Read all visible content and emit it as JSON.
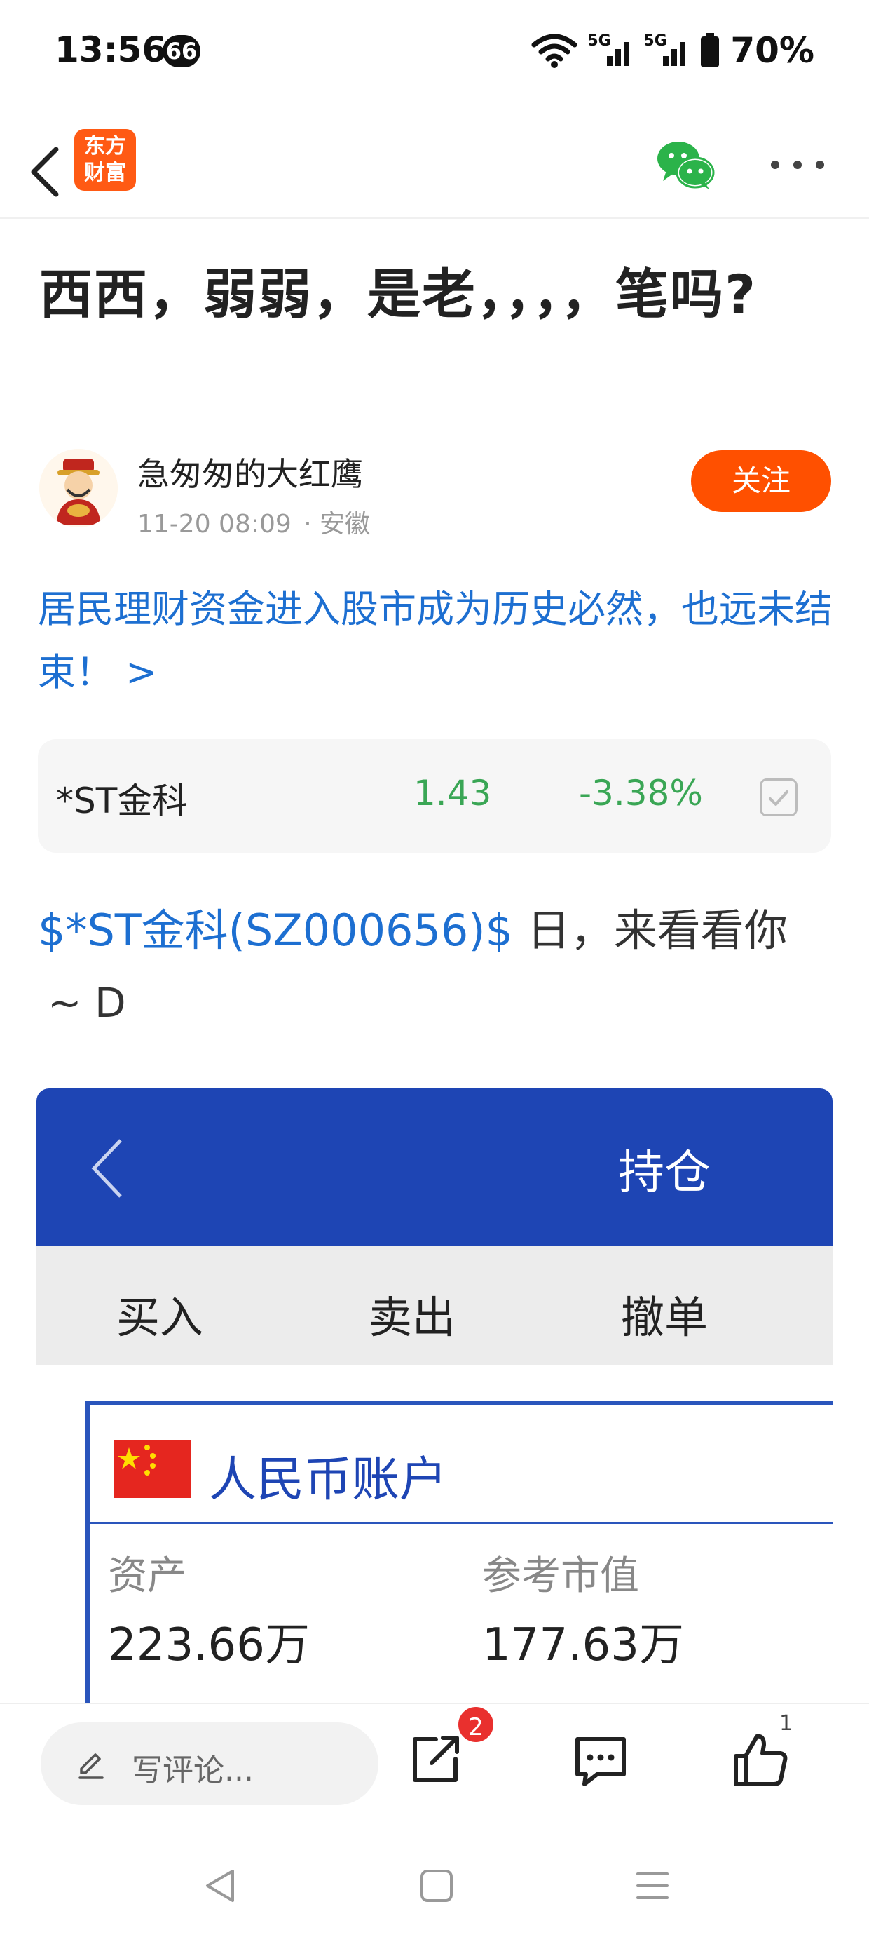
{
  "status_bar": {
    "time": "13:56",
    "notification_badge": "66",
    "network_1": "5G",
    "network_2": "5G",
    "battery": "70%"
  },
  "header": {
    "logo_line1": "东方",
    "logo_line2": "财富",
    "icons": [
      "back-icon",
      "wechat-icon",
      "more-icon"
    ]
  },
  "post": {
    "title": "西西，弱弱，是老，，，，笔吗?",
    "author": "急匆匆的大红鹰",
    "time": "11-20 08:09",
    "location": "· 安徽",
    "follow_label": "关注",
    "headline_link": "居民理财资金进入股市成为历史必然，也远未结束！ >",
    "body_stock_link": "$*ST金科(SZ000656)$",
    "body_text": " 日，来看看你",
    "body_line2": "~ D"
  },
  "stock_card": {
    "name": "*ST金科",
    "price": "1.43",
    "change": "-3.38%",
    "change_color": "#3aa655"
  },
  "embedded_screenshot": {
    "title": "持仓",
    "tabs": [
      "买入",
      "卖出",
      "撤单"
    ],
    "account_title": "人民币账户",
    "fields": [
      {
        "label": "资产",
        "value": "223.66万"
      },
      {
        "label": "参考市值",
        "value": "177.63万"
      }
    ]
  },
  "bottom_bar": {
    "comment_placeholder": "写评论...",
    "share_badge": "2",
    "like_count": "1"
  },
  "colors": {
    "accent": "#ff5000",
    "link": "#1d6fd1",
    "down": "#3aa655",
    "embedded_header": "#1e45b4"
  }
}
